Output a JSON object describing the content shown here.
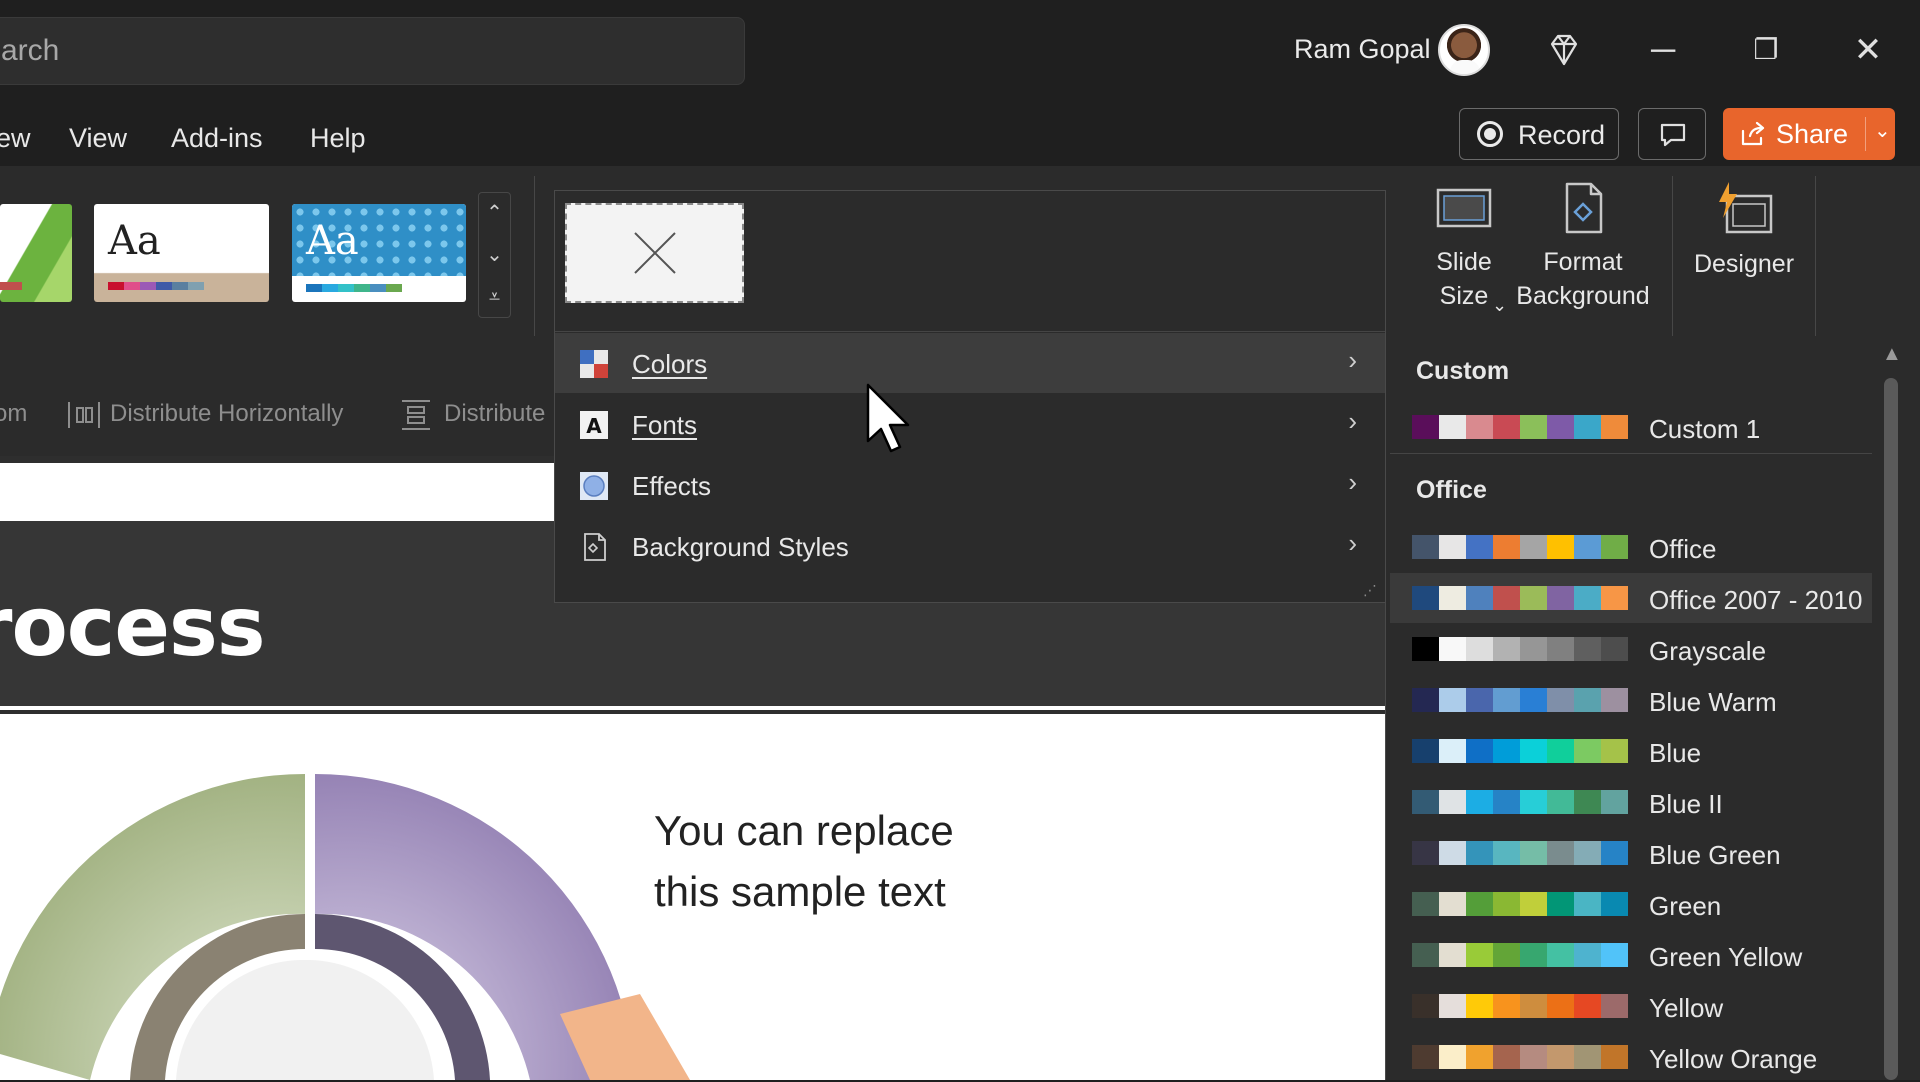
{
  "titlebar": {
    "search_placeholder": "arch",
    "user_name": "Ram Gopal",
    "diamond_icon": "premium-diamond-icon",
    "minimize": "─",
    "restore": "❐",
    "close": "✕"
  },
  "menu_tabs": [
    "ew",
    "View",
    "Add-ins",
    "Help"
  ],
  "actions": {
    "record_label": "Record",
    "share_label": "Share"
  },
  "ribbon": {
    "arrange": {
      "left_label": "om",
      "distribute_h": "Distribute Horizontally",
      "distribute_v": "Distribute"
    },
    "slide_size": "Slide Size",
    "format_background": "Format Background",
    "designer": "Designer",
    "theme_sample": "Aa"
  },
  "slide": {
    "title_fragment": "rocess",
    "sample_line1": "You can replace",
    "sample_line2": "this sample text"
  },
  "design_menu": {
    "items": [
      {
        "label": "Colors",
        "icon": "colors-icon"
      },
      {
        "label": "Fonts",
        "icon": "fonts-icon"
      },
      {
        "label": "Effects",
        "icon": "effects-icon"
      },
      {
        "label": "Background Styles",
        "icon": "background-styles-icon"
      }
    ]
  },
  "colors_panel": {
    "custom_header": "Custom",
    "office_header": "Office",
    "custom_schemes": [
      {
        "name": "Custom 1",
        "swatches": [
          "#5a0e5a",
          "#e9e9e9",
          "#d98a8f",
          "#c94a54",
          "#8bbf5a",
          "#7e5aa8",
          "#3aa7c9",
          "#ef8b3a"
        ]
      }
    ],
    "office_schemes": [
      {
        "name": "Office",
        "swatches": [
          "#44546a",
          "#e7e6e6",
          "#4472c4",
          "#ed7d31",
          "#a5a5a5",
          "#ffc000",
          "#5b9bd5",
          "#70ad47"
        ]
      },
      {
        "name": "Office 2007 - 2010",
        "swatches": [
          "#1f497d",
          "#eeece1",
          "#4f81bd",
          "#c0504d",
          "#9bbb59",
          "#8064a2",
          "#4bacc6",
          "#f79646"
        ]
      },
      {
        "name": "Grayscale",
        "swatches": [
          "#000000",
          "#f8f8f8",
          "#dddddd",
          "#b2b2b2",
          "#969696",
          "#808080",
          "#5f5f5f",
          "#4d4d4d"
        ]
      },
      {
        "name": "Blue Warm",
        "swatches": [
          "#242852",
          "#acccea",
          "#4a66ac",
          "#629dd1",
          "#297fd5",
          "#7f8fa9",
          "#5aa2ae",
          "#9d90a0"
        ]
      },
      {
        "name": "Blue",
        "swatches": [
          "#17406d",
          "#dbeff9",
          "#0f6fc6",
          "#009dd9",
          "#0bd0d9",
          "#10cf9b",
          "#7cca62",
          "#a5c249"
        ]
      },
      {
        "name": "Blue II",
        "swatches": [
          "#335b74",
          "#dfe3e5",
          "#1cade4",
          "#2683c6",
          "#27ced7",
          "#42ba97",
          "#3e8853",
          "#62a39f"
        ]
      },
      {
        "name": "Blue Green",
        "swatches": [
          "#373545",
          "#cedbe6",
          "#3494ba",
          "#58b6c0",
          "#75bda7",
          "#7a8c8e",
          "#84acb6",
          "#2683c6"
        ]
      },
      {
        "name": "Green",
        "swatches": [
          "#455f51",
          "#e3ded1",
          "#549e39",
          "#8ab833",
          "#c0cf3a",
          "#029676",
          "#4ab5c4",
          "#0989b1"
        ]
      },
      {
        "name": "Green Yellow",
        "swatches": [
          "#455f51",
          "#e3ded1",
          "#99cb38",
          "#63a537",
          "#37a76f",
          "#44c1a3",
          "#4eb3cf",
          "#51c3f9"
        ]
      },
      {
        "name": "Yellow",
        "swatches": [
          "#39302a",
          "#e5dedb",
          "#ffca08",
          "#f8931d",
          "#ce8d3e",
          "#ec7016",
          "#e64823",
          "#9c6a6a"
        ]
      },
      {
        "name": "Yellow Orange",
        "swatches": [
          "#4e3b30",
          "#fbeec9",
          "#f0a22e",
          "#a5644e",
          "#b58b80",
          "#c3986d",
          "#a19574",
          "#c17529"
        ]
      }
    ]
  }
}
